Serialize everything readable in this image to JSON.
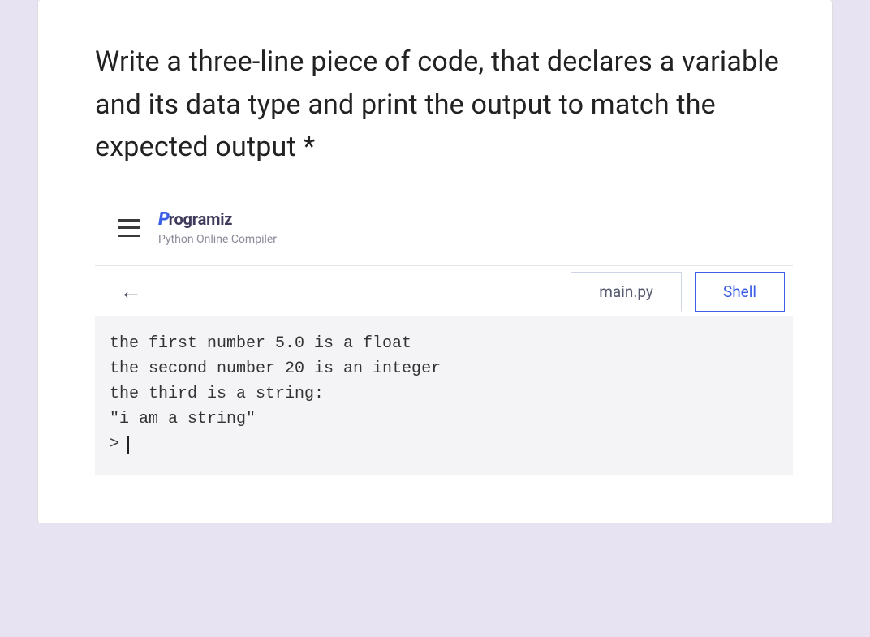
{
  "question": {
    "text": "Write a three-line piece of code, that declares a variable and its data type and print the output to match the expected output ",
    "required_marker": "*"
  },
  "compiler": {
    "brand_first": "P",
    "brand_rest": "rogramiz",
    "subtitle": "Python Online Compiler",
    "tabs": {
      "main": "main.py",
      "shell": "Shell"
    },
    "back_arrow": "←",
    "output_lines": [
      "the first number 5.0 is a float",
      "the second number 20 is an integer",
      "the third is a string:",
      "\"i am a string\""
    ],
    "prompt": ">"
  }
}
